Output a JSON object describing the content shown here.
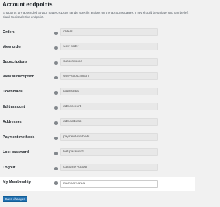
{
  "section": {
    "title": "Account endpoints",
    "description": "Endpoints are appended to your page URLs to handle specific actions on the accounts pages. They should be unique and can be left blank to disable the endpoint."
  },
  "endpoints": [
    {
      "label": "Orders",
      "value": "orders"
    },
    {
      "label": "View order",
      "value": "view-order"
    },
    {
      "label": "Subscriptions",
      "value": "subscriptions"
    },
    {
      "label": "View subscription",
      "value": "view-subscription"
    },
    {
      "label": "Downloads",
      "value": "downloads"
    },
    {
      "label": "Edit account",
      "value": "edit-account"
    },
    {
      "label": "Addresses",
      "value": "edit-address"
    },
    {
      "label": "Payment methods",
      "value": "payment-methods"
    },
    {
      "label": "Lost password",
      "value": "lost-password"
    },
    {
      "label": "Logout",
      "value": "customer-logout"
    },
    {
      "label": "My Membership",
      "value": "members-area"
    }
  ],
  "save_label": "Save changes",
  "colors": {
    "primary_button": "#2271b1",
    "highlight_row": "#ffffff",
    "background": "#f1f1f1"
  },
  "icons": {
    "help": "help-tip-icon"
  }
}
